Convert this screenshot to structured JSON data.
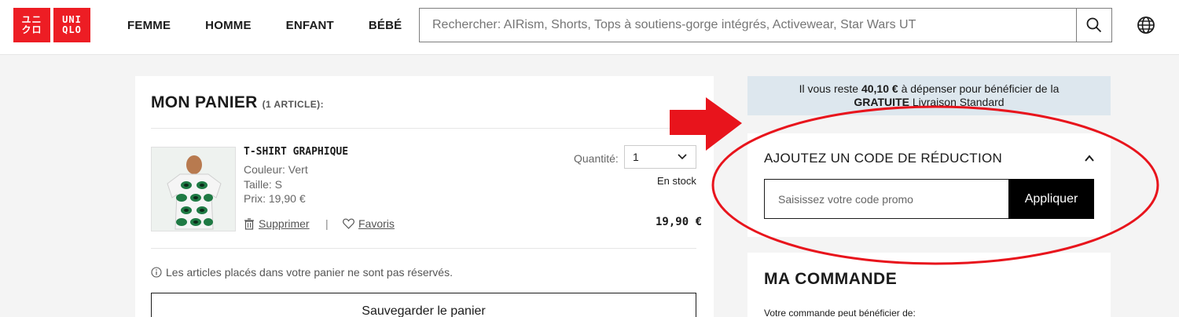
{
  "header": {
    "logo_lines": [
      "ユニ",
      "クロ",
      "UNI",
      "QLO"
    ],
    "nav": [
      "FEMME",
      "HOMME",
      "ENFANT",
      "BÉBÉ"
    ],
    "search_placeholder": "Rechercher: AIRism, Shorts, Tops à soutiens-gorge intégrés, Activewear, Star Wars UT",
    "icons": {
      "search": "search-icon",
      "language": "globe-icon"
    }
  },
  "cart": {
    "title": "MON PANIER",
    "count": "(1 ARTICLE):",
    "item": {
      "name": "T-SHIRT GRAPHIQUE",
      "color": "Couleur: Vert",
      "size": "Taille: S",
      "price_line": "Prix: 19,90 €",
      "quantity_label": "Quantité:",
      "quantity_value": "1",
      "stock": "En stock",
      "delete_label": "Supprimer",
      "favorite_label": "Favoris",
      "total": "19,90 €"
    },
    "notice": "Les articles placés dans votre panier ne sont pas réservés.",
    "save_label": "Sauvegarder le panier"
  },
  "shipping": {
    "line1_pre": "Il vous reste ",
    "amount": "40,10 €",
    "line1_post": " à dépenser pour bénéficier de la",
    "free": "GRATUITE",
    "line2_post": " Livraison Standard"
  },
  "promo": {
    "title": "AJOUTEZ UN CODE DE RÉDUCTION",
    "placeholder": "Saisissez votre code promo",
    "apply_label": "Appliquer"
  },
  "order": {
    "title": "MA COMMANDE",
    "subtitle": "Votre commande peut bénéficier de:"
  },
  "colors": {
    "brand": "#ed1d24",
    "annotation": "#e8141c",
    "shipping_bg": "#dde7ee"
  }
}
